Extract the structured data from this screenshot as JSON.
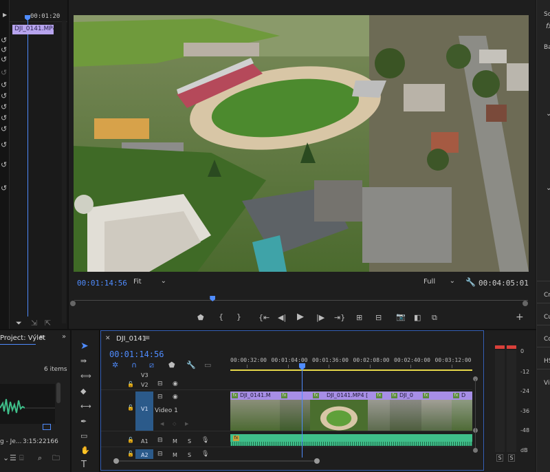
{
  "source_panel": {
    "timecode": "00:01:20",
    "clip_label": "DJI_0141.MP4"
  },
  "program_monitor": {
    "current_time": "00:01:14:56",
    "fit_option": "Fit",
    "quality_option": "Full",
    "duration": "00:04:05:01",
    "playhead_fraction": 0.305
  },
  "project_panel": {
    "title": "Project: Výlet",
    "items_count": "6 items",
    "clip_name": "g - Je...",
    "clip_duration": "3:15:22166"
  },
  "timeline": {
    "tab_title": "DJI_0141",
    "current_time": "00:01:14:56",
    "ruler_labels": [
      "00:00:32:00",
      "00:01:04:00",
      "00:01:36:00",
      "00:02:08:00",
      "00:02:40:00",
      "00:03:12:00"
    ],
    "tracks": {
      "v3": "V3",
      "v2": "V2",
      "v1": "V1",
      "v1_name": "Video 1",
      "a1": "A1",
      "a2": "A2"
    },
    "clips": [
      {
        "label": "DJI_0141.M"
      },
      {
        "label": "DJI_0141.MP4 [15"
      },
      {
        "label": "DJI_0"
      },
      {
        "label": "D"
      }
    ]
  },
  "right_panel": {
    "labels": [
      "So",
      "fx",
      "Ba",
      "Cr",
      "Cu",
      "Co",
      "HS",
      "Vi"
    ]
  },
  "audio_meter": {
    "scale": [
      "0",
      "-12",
      "-24",
      "-36",
      "-48",
      "dB"
    ],
    "solo_left": "S",
    "solo_right": "S"
  },
  "colors": {
    "accent": "#4f8cff",
    "clip_video": "#a78ee6",
    "clip_audio": "#3fbf8a",
    "meter_red": "#d9403a"
  }
}
